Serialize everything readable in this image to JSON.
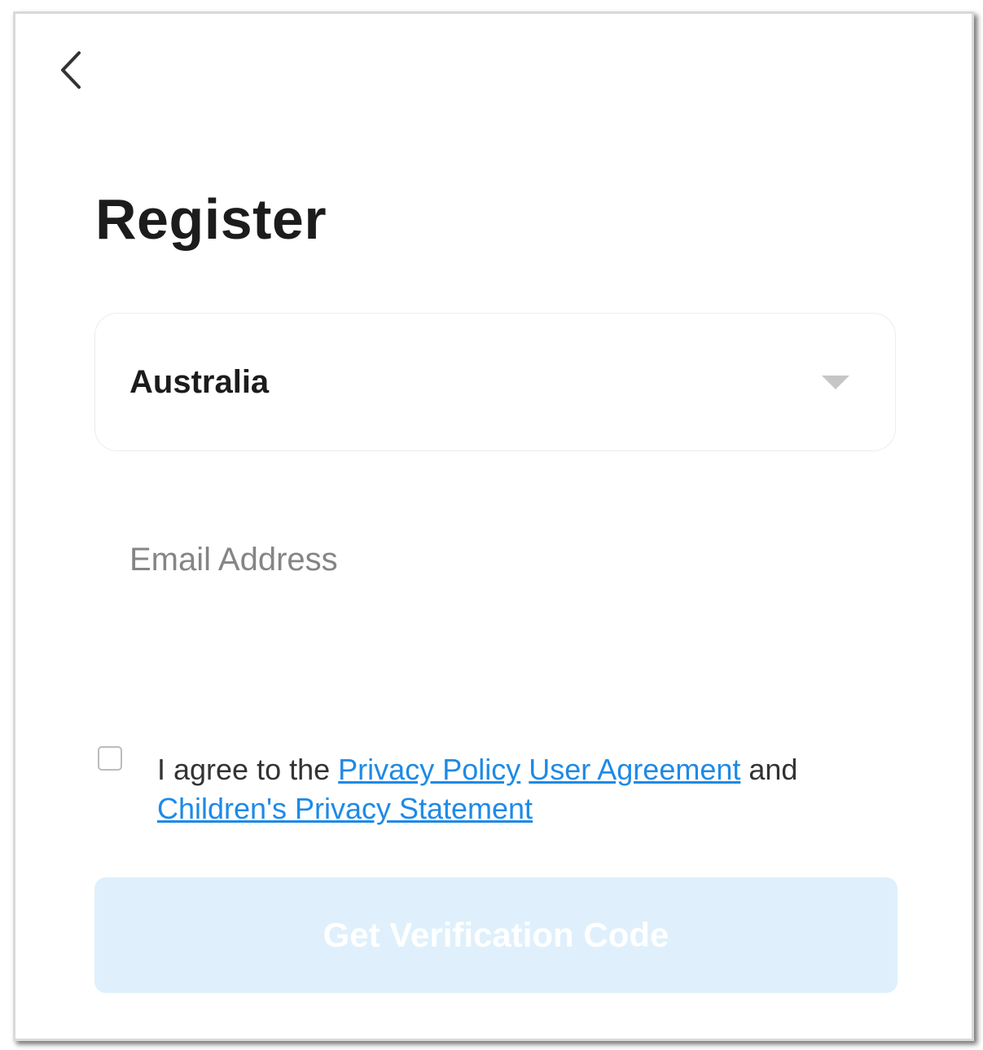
{
  "header": {
    "back_icon": "chevron-left-icon",
    "title": "Register"
  },
  "region": {
    "value": "Australia",
    "caret_icon": "caret-down-icon"
  },
  "email": {
    "placeholder": "Email Address",
    "value": ""
  },
  "agreement": {
    "checked": false,
    "prefix": "I agree to the",
    "privacy_policy": "Privacy Policy",
    "user_agreement": "User Agreement",
    "conjunction": "and",
    "childrens_privacy": "Children's Privacy Statement"
  },
  "submit": {
    "label": "Get Verification Code",
    "enabled": false
  },
  "colors": {
    "link": "#1e8ae6",
    "button_disabled_bg": "#dff0fc",
    "title_text": "#1c1c1c",
    "placeholder_text": "#858585"
  }
}
